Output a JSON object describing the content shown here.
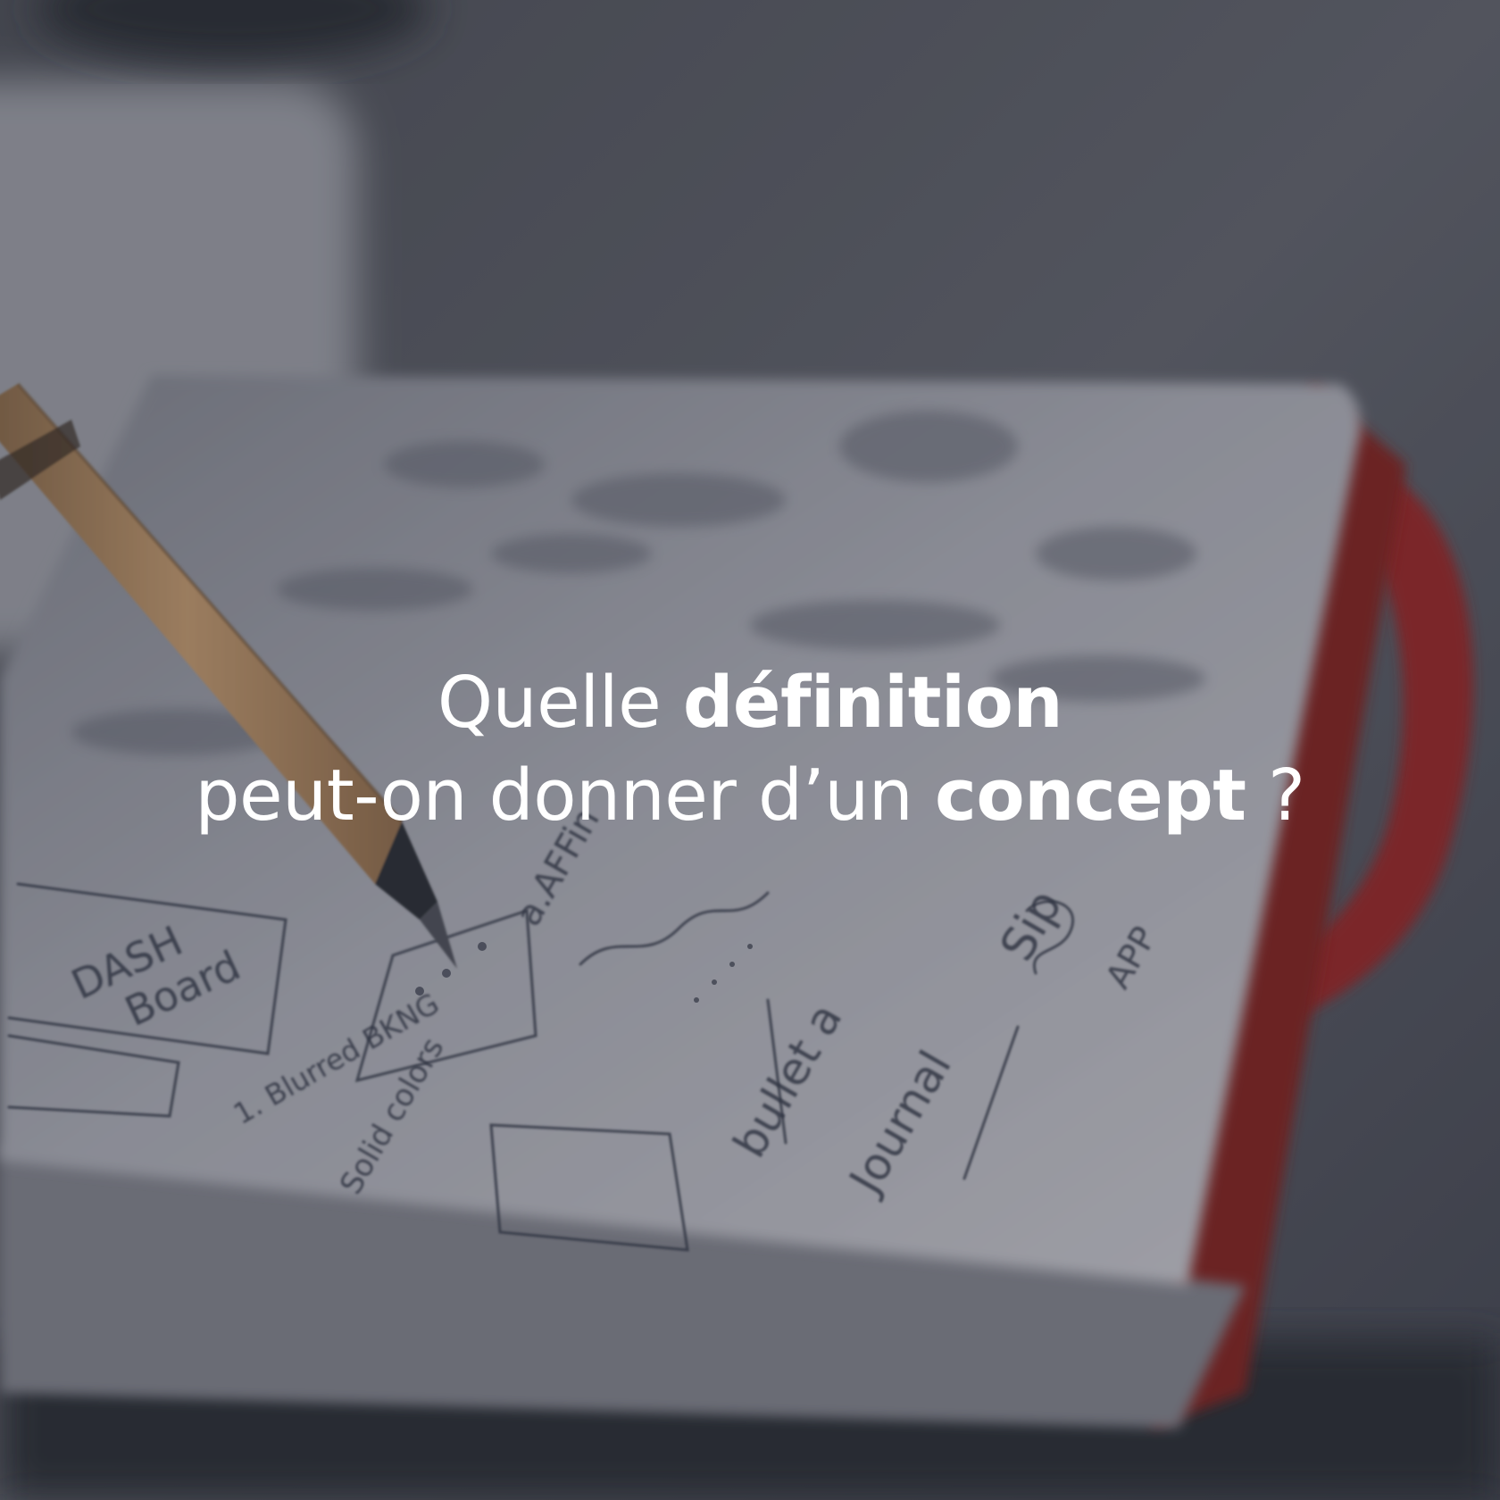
{
  "headline": {
    "line1": {
      "pre": "Quelle ",
      "bold": "définition",
      "post": ""
    },
    "line2": {
      "pre": "peut-on donner d’un ",
      "bold": "concept",
      "post": " ?"
    }
  },
  "background": {
    "description_icon": "notebook-with-pencil-photo",
    "handwriting": {
      "dash_board": "DASH Board",
      "blurred_bkng": "1. Blurred BKNG",
      "solid_colors": "Solid colors",
      "affine": "a.AFFin",
      "bullet_journal": "bullet a Journal",
      "sip": "Sip",
      "app": "APP"
    },
    "colors": {
      "scrim": "#1c1e28",
      "paper": "#cfcfd6",
      "ribbon": "#b8322c",
      "pencil": "#c79a68",
      "desk": "#4a4c58"
    }
  }
}
